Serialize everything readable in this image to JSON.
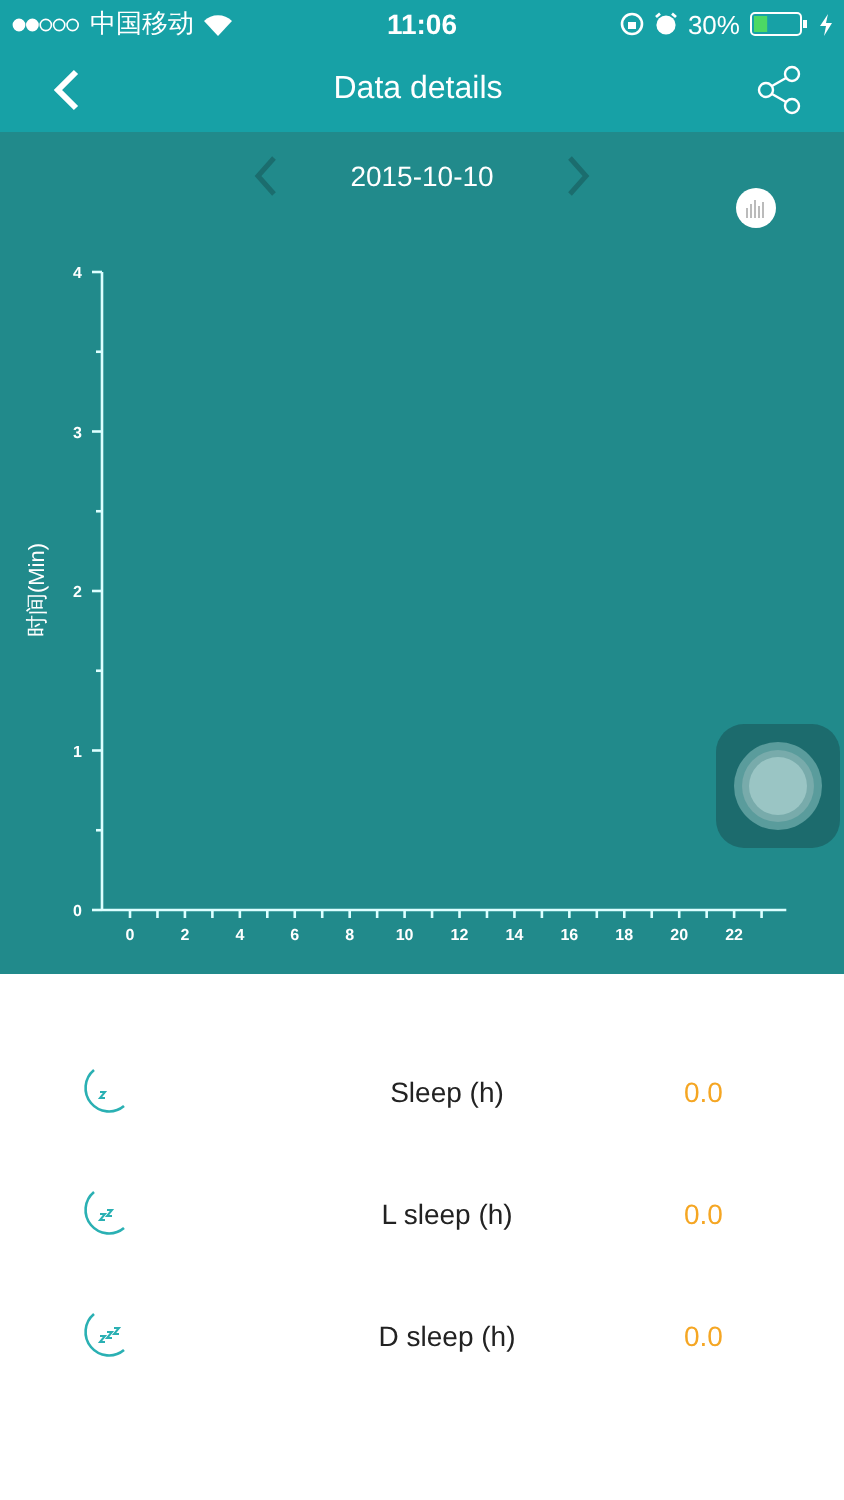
{
  "status_bar": {
    "carrier": "中国移动",
    "time": "11:06",
    "battery": "30%"
  },
  "nav": {
    "title": "Data details"
  },
  "date_nav": {
    "date": "2015-10-10"
  },
  "chart": {
    "chart_data": {
      "type": "bar",
      "ylabel": "时间(Min)",
      "categories": [
        "0",
        "2",
        "4",
        "6",
        "8",
        "10",
        "12",
        "14",
        "16",
        "18",
        "20",
        "22"
      ],
      "values": [
        0,
        0,
        0,
        0,
        0,
        0,
        0,
        0,
        0,
        0,
        0,
        0
      ],
      "ylim": [
        0,
        4
      ],
      "yticks": [
        0,
        1,
        2,
        3,
        4
      ]
    }
  },
  "stats": [
    {
      "kind": "sleep",
      "label": "Sleep (h)",
      "value": "0.0"
    },
    {
      "kind": "light",
      "label": "L sleep (h)",
      "value": "0.0"
    },
    {
      "kind": "deep",
      "label": "D sleep (h)",
      "value": "0.0"
    }
  ]
}
